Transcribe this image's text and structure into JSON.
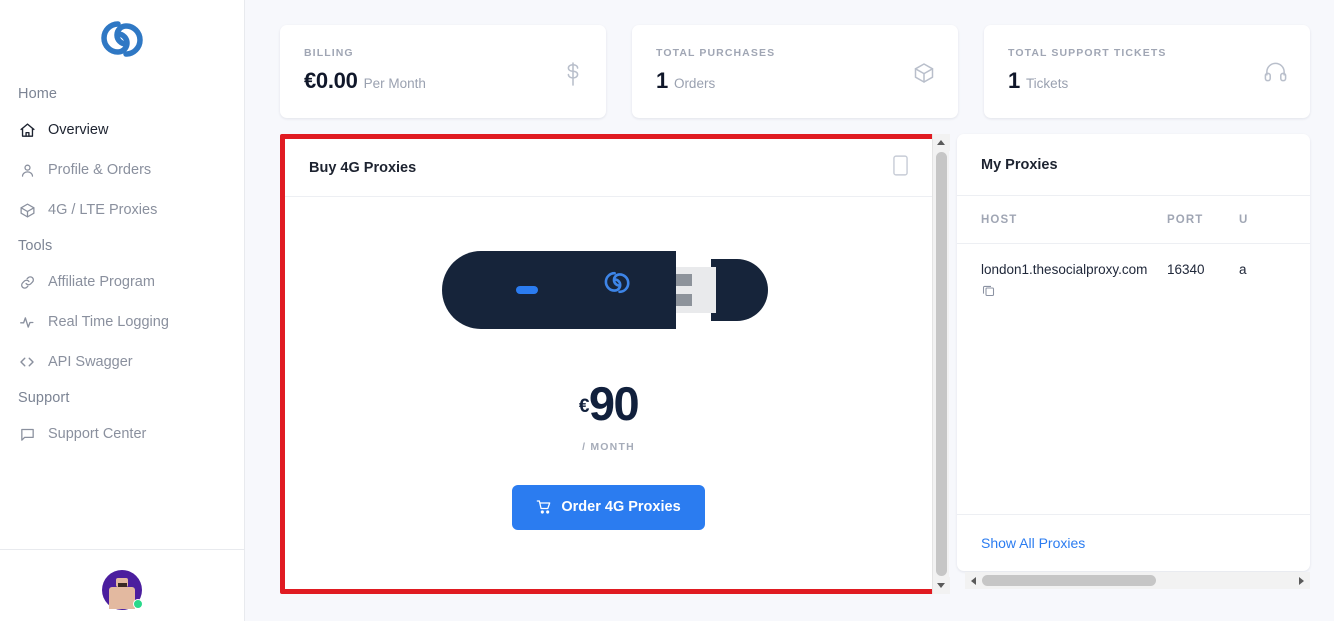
{
  "brand": {
    "logo_icon": "spiral-links-logo",
    "accent_color": "#2b7cf0",
    "dark_color": "#11203c",
    "highlight_color": "#e01b22"
  },
  "sidebar": {
    "groups": [
      {
        "label": "Home",
        "items": [
          {
            "label": "Overview",
            "icon": "home-icon",
            "active": true
          },
          {
            "label": "Profile & Orders",
            "icon": "user-icon",
            "active": false
          },
          {
            "label": "4G / LTE Proxies",
            "icon": "box-icon",
            "active": false
          }
        ]
      },
      {
        "label": "Tools",
        "items": [
          {
            "label": "Affiliate Program",
            "icon": "link-icon",
            "active": false
          },
          {
            "label": "Real Time Logging",
            "icon": "activity-icon",
            "active": false
          },
          {
            "label": "API Swagger",
            "icon": "code-icon",
            "active": false
          }
        ]
      },
      {
        "label": "Support",
        "items": [
          {
            "label": "Support Center",
            "icon": "chat-icon",
            "active": false
          }
        ]
      }
    ],
    "footer": {
      "avatar_name": "user-avatar",
      "status": "online"
    }
  },
  "stats": [
    {
      "label": "BILLING",
      "value": "€0.00",
      "unit": "Per Month",
      "icon": "dollar-icon"
    },
    {
      "label": "TOTAL PURCHASES",
      "value": "1",
      "unit": "Orders",
      "icon": "package-icon"
    },
    {
      "label": "TOTAL SUPPORT TICKETS",
      "value": "1",
      "unit": "Tickets",
      "icon": "headset-icon"
    }
  ],
  "buy_card": {
    "title": "Buy 4G Proxies",
    "header_icon": "smartphone-icon",
    "product_image": "usb-4g-dongle",
    "currency": "€",
    "price": "90",
    "period": "/ MONTH",
    "button_label": "Order 4G Proxies",
    "button_icon": "cart-icon"
  },
  "proxies_card": {
    "title": "My Proxies",
    "columns": [
      "HOST",
      "PORT",
      "U"
    ],
    "rows": [
      {
        "host": "london1.thesocialproxy.com",
        "port": "16340",
        "username": "a",
        "copy_icon": "copy-icon"
      }
    ],
    "footer_link": "Show All Proxies"
  }
}
